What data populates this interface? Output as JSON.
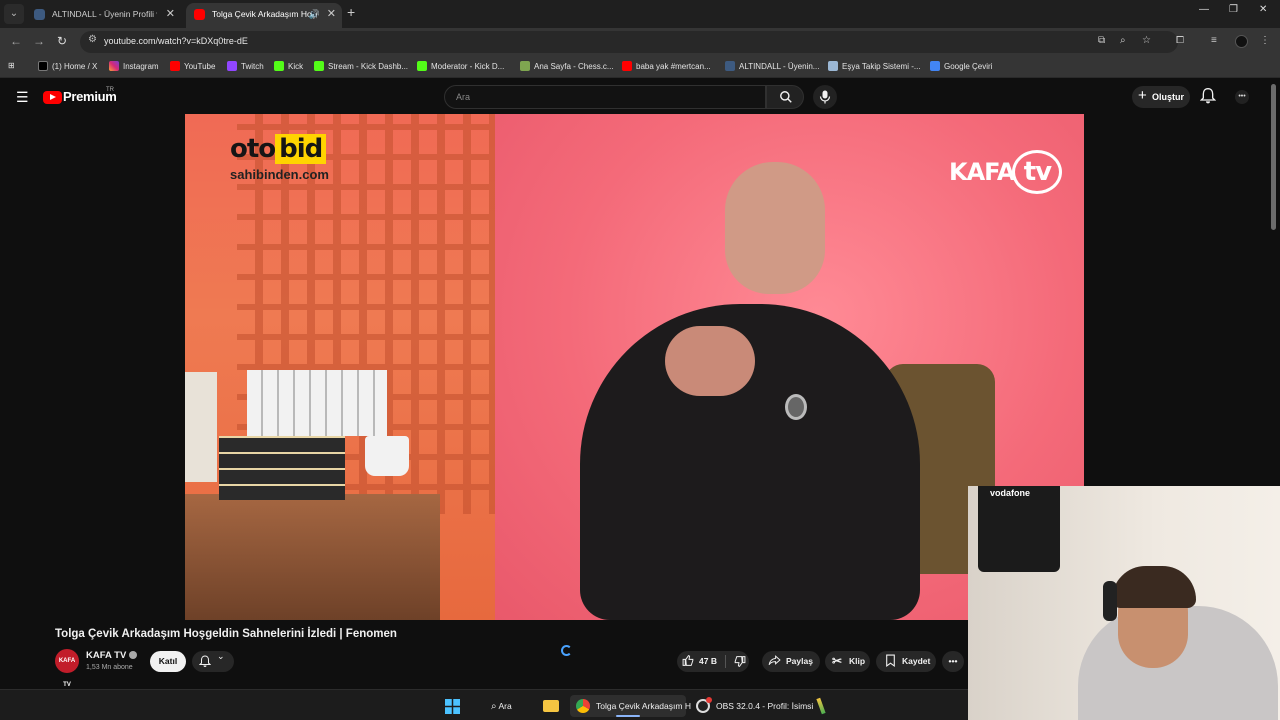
{
  "browser": {
    "tabs": [
      {
        "title": "ALTINDALL - Üyenin Profili ve İs",
        "active": false
      },
      {
        "title": "Tolga Çevik Arkadaşım Hoşgeldin",
        "active": true
      }
    ],
    "url": "youtube.com/watch?v=kDXq0tre-dE",
    "bookmarks": [
      {
        "label": "(1) Home / X",
        "icon": "x-icon"
      },
      {
        "label": "Instagram",
        "icon": "instagram-icon"
      },
      {
        "label": "YouTube",
        "icon": "youtube-icon"
      },
      {
        "label": "Twitch",
        "icon": "twitch-icon"
      },
      {
        "label": "Kick",
        "icon": "kick-icon"
      },
      {
        "label": "Stream - Kick Dashb...",
        "icon": "kick-icon"
      },
      {
        "label": "Moderator - Kick D...",
        "icon": "kick-icon"
      },
      {
        "label": "Ana Sayfa - Chess.c...",
        "icon": "chess-icon"
      },
      {
        "label": "baba yak #mertcan...",
        "icon": "youtube-icon"
      },
      {
        "label": "ALTINDALL - Üyenin...",
        "icon": "site-icon"
      },
      {
        "label": "Eşya Takip Sistemi -...",
        "icon": "feather-icon"
      },
      {
        "label": "Google Çeviri",
        "icon": "translate-icon"
      }
    ]
  },
  "youtube": {
    "brand": "Premium",
    "region": "TR",
    "search_placeholder": "Ara",
    "create_label": "Oluştur",
    "video_overlays": {
      "sponsor_main": "oto",
      "sponsor_accent": "bid",
      "sponsor_sub": "sahibinden.com",
      "channel_logo_left": "KAFA",
      "channel_logo_right": "tv"
    },
    "cam_overlay": {
      "jersey_text": "vodafone"
    },
    "video": {
      "title": "Tolga Çevik Arkadaşım Hoşgeldin Sahnelerini İzledi | Fenomen",
      "channel": "KAFA TV",
      "channel_avatar_text": "KAFA TV",
      "subscribers": "1,53 Mn abone",
      "join_label": "Katıl",
      "likes": "47 B",
      "share_label": "Paylaş",
      "clip_label": "Klip",
      "save_label": "Kaydet"
    }
  },
  "taskbar": {
    "search_label": "Ara",
    "chrome_item": "Tolga Çevik Arkadaşım H",
    "obs_item": "OBS 32.0.4 - Profil: İsimsi"
  },
  "colors": {
    "youtube_red": "#ff0000",
    "background": "#0f0f0f",
    "chrome_toolbar": "#353535"
  }
}
